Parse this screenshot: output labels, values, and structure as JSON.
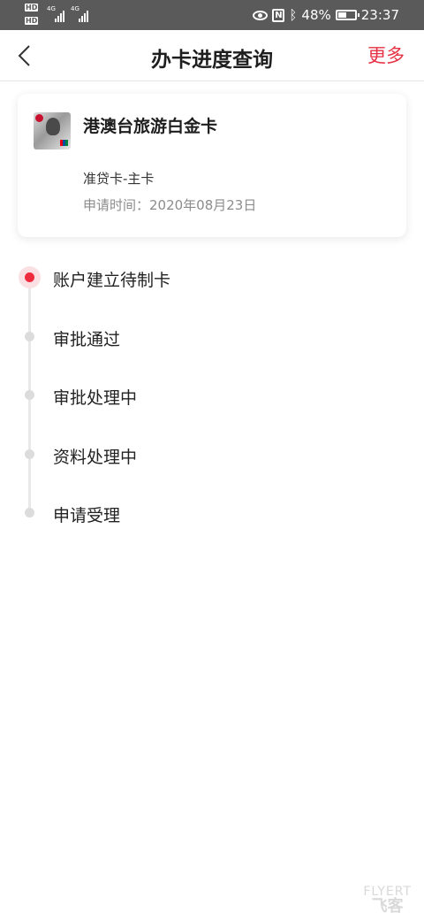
{
  "status_bar": {
    "hd": "HD",
    "network_1": "4G",
    "network_2": "4G",
    "battery_percent": "48%",
    "time": "23:37",
    "icons": [
      "eye-icon",
      "nfc-icon",
      "bluetooth-icon",
      "battery-icon"
    ]
  },
  "nav": {
    "title": "办卡进度查询",
    "more_label": "更多",
    "back_icon": "chevron-left-icon"
  },
  "card": {
    "name": "港澳台旅游白金卡",
    "type": "准贷卡-主卡",
    "date": "申请时间：2020年08月23日"
  },
  "steps": [
    {
      "label": "账户建立待制卡",
      "active": true
    },
    {
      "label": "审批通过",
      "active": false
    },
    {
      "label": "审批处理中",
      "active": false
    },
    {
      "label": "资料处理中",
      "active": false
    },
    {
      "label": "申请受理",
      "active": false
    }
  ],
  "watermark": {
    "top": "FLYERT",
    "bottom": "飞客"
  },
  "colors": {
    "accent": "#e63244",
    "active_dot": "#ef2b3e",
    "status_bar_bg": "#5a5a5a"
  }
}
